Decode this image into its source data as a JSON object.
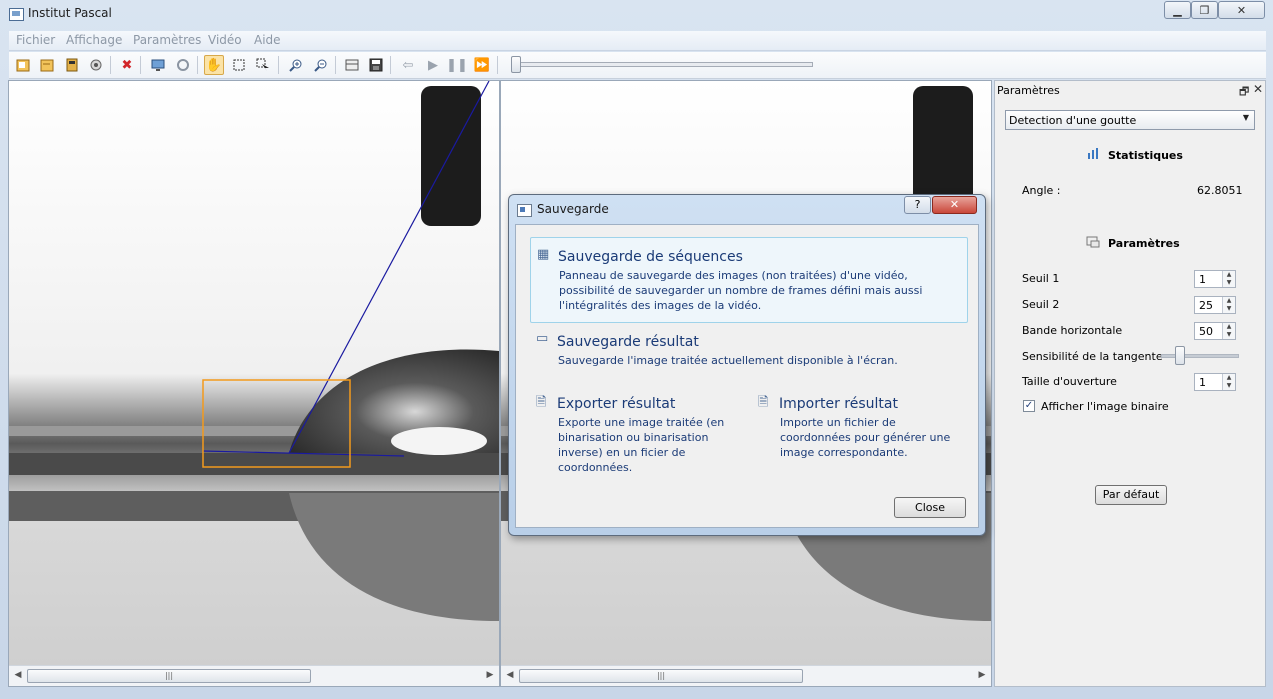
{
  "window": {
    "title": "Institut Pascal",
    "minimize": "▁",
    "maximize": "❐",
    "close": "✕"
  },
  "menu": [
    "Fichier",
    "Affichage",
    "Paramètres",
    "Vidéo",
    "Aide"
  ],
  "toolbar_icons": [
    "open-icon",
    "open-folder-icon",
    "open-video-icon",
    "camera-icon",
    "delete-icon",
    "monitor-icon",
    "process-icon",
    "hand-tool-icon",
    "rect-select-icon",
    "pointer-select-icon",
    "zoom-in-icon",
    "zoom-out-icon",
    "fit-icon",
    "save-icon",
    "prev-icon",
    "play-icon",
    "pause-icon",
    "next-icon"
  ],
  "video_position": 0.0,
  "panes": {
    "left_scroll_thumb": "|||",
    "right_scroll_thumb": "|||"
  },
  "dock": {
    "title": "Paramètres",
    "float_glyph": "🗗",
    "close_glyph": "✕",
    "mode": "Detection d'une goutte",
    "stats_title": "Statistiques",
    "angle_label": "Angle :",
    "angle_value": "62.8051",
    "params_title": "Paramètres",
    "seuil1_label": "Seuil 1",
    "seuil1_value": "1",
    "seuil2_label": "Seuil 2",
    "seuil2_value": "25",
    "bande_label": "Bande horizontale",
    "bande_value": "50",
    "sensibilite_label": "Sensibilité de la tangente",
    "sensibilite_level": 0.2,
    "taille_label": "Taille d'ouverture",
    "taille_value": "1",
    "binaire_label": "Afficher l'image binaire",
    "binaire_checked": true,
    "default_button": "Par défaut"
  },
  "dialog": {
    "title": "Sauvegarde",
    "help": "?",
    "close_glyph": "✕",
    "seq_title": "Sauvegarde de séquences",
    "seq_desc": "Panneau de sauvegarde des images (non traitées) d'une vidéo, possibilité de sauvegarder un nombre de frames défini mais aussi l'intégralités des images de la vidéo.",
    "result_title": "Sauvegarde résultat",
    "result_desc": "Sauvegarde l'image traitée actuellement disponible à l'écran.",
    "export_title": "Exporter résultat",
    "export_desc": "Exporte une image traitée (en binarisation ou binarisation inverse) en un ficier de coordonnées.",
    "import_title": "Importer résultat",
    "import_desc": "Importe un fichier de coordonnées pour générer une image correspondante.",
    "close_button": "Close"
  },
  "colors": {
    "roi_box": "#f39a1c",
    "tangent_line": "#1a1aa0",
    "dialog_link": "#1b3b77"
  }
}
